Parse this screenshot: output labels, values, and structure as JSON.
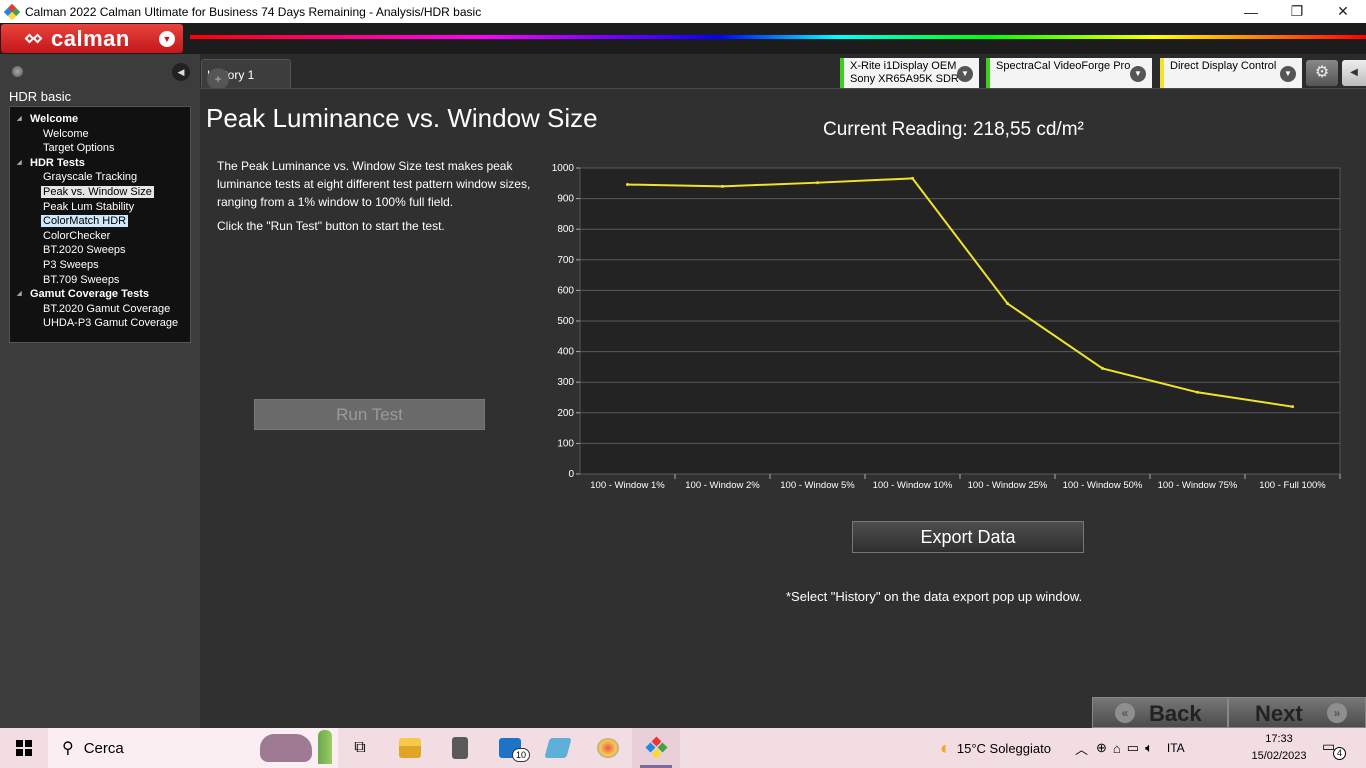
{
  "window": {
    "title": "Calman 2022 Calman Ultimate for Business 74 Days Remaining  - Analysis/HDR basic",
    "minimize_icon": "minimize-icon",
    "maximize_icon": "restore-icon",
    "close_icon": "close-icon",
    "minimize_glyph": "—",
    "maximize_glyph": "❐",
    "close_glyph": "✕"
  },
  "brand": {
    "logo_text": "calman",
    "accent": "#c4161c"
  },
  "sidebar": {
    "title": "HDR basic",
    "tree": [
      {
        "label": "Welcome",
        "type": "group"
      },
      {
        "label": "Welcome",
        "type": "child"
      },
      {
        "label": "Target Options",
        "type": "child"
      },
      {
        "label": "HDR Tests",
        "type": "group"
      },
      {
        "label": "Grayscale Tracking",
        "type": "child"
      },
      {
        "label": "Peak vs. Window Size",
        "type": "child",
        "state": "selected"
      },
      {
        "label": "Peak Lum Stability",
        "type": "child"
      },
      {
        "label": "ColorMatch HDR",
        "type": "child",
        "state": "hover"
      },
      {
        "label": "ColorChecker",
        "type": "child"
      },
      {
        "label": "BT.2020 Sweeps",
        "type": "child"
      },
      {
        "label": "P3 Sweeps",
        "type": "child"
      },
      {
        "label": "BT.709 Sweeps",
        "type": "child"
      },
      {
        "label": "Gamut Coverage Tests",
        "type": "group"
      },
      {
        "label": "BT.2020 Gamut Coverage",
        "type": "child"
      },
      {
        "label": "UHDA-P3 Gamut Coverage",
        "type": "child"
      }
    ]
  },
  "tabs": {
    "history": "History 1",
    "add": "+"
  },
  "devices": {
    "meter_line1": "X-Rite i1Display OEM",
    "meter_line2": "Sony XR65A95K SDR",
    "meter_color": "#3ecf1e",
    "source": "SpectraCal VideoForge Pro",
    "source_color": "#3ecf1e",
    "display": "Direct Display Control",
    "display_color": "#f2e32a",
    "dropdown_glyph": "▼",
    "settings_glyph": "⚙",
    "collapse_glyph": "◀"
  },
  "main": {
    "title": "Peak Luminance vs. Window Size",
    "description": "The Peak Luminance vs. Window Size test makes peak luminance tests at eight different test pattern window sizes, ranging from a 1% window to 100% full field.",
    "instruction": "Click the \"Run Test\" button to start the test.",
    "run_button": "Run Test",
    "current_reading": "Current Reading: 218,55 cd/m²",
    "export_button": "Export  Data",
    "export_note": "*Select \"History\" on the data export pop up window.",
    "back_button": "Back",
    "next_button": "Next",
    "back_glyph": "«",
    "next_glyph": "»"
  },
  "chart_data": {
    "type": "line",
    "categories": [
      "100 - Window  1%",
      "100 - Window  2%",
      "100 - Window  5%",
      "100 - Window 10%",
      "100 - Window 25%",
      "100 - Window 50%",
      "100 - Window 75%",
      "100 - Full  100%"
    ],
    "series": [
      {
        "values": [
          946,
          940,
          952,
          966,
          557,
          345,
          267,
          220
        ],
        "color": "#f2e32a"
      }
    ],
    "ylim": [
      0,
      1000
    ],
    "yticks": [
      0,
      100,
      200,
      300,
      400,
      500,
      600,
      700,
      800,
      900,
      1000
    ],
    "grid": true,
    "title": "",
    "xlabel": "",
    "ylabel": ""
  },
  "taskbar": {
    "search_placeholder": "Cerca",
    "mail_badge": "10",
    "weather": "15°C  Soleggiato",
    "language": "ITA",
    "time": "17:33",
    "date": "15/02/2023",
    "notifications": "4"
  }
}
